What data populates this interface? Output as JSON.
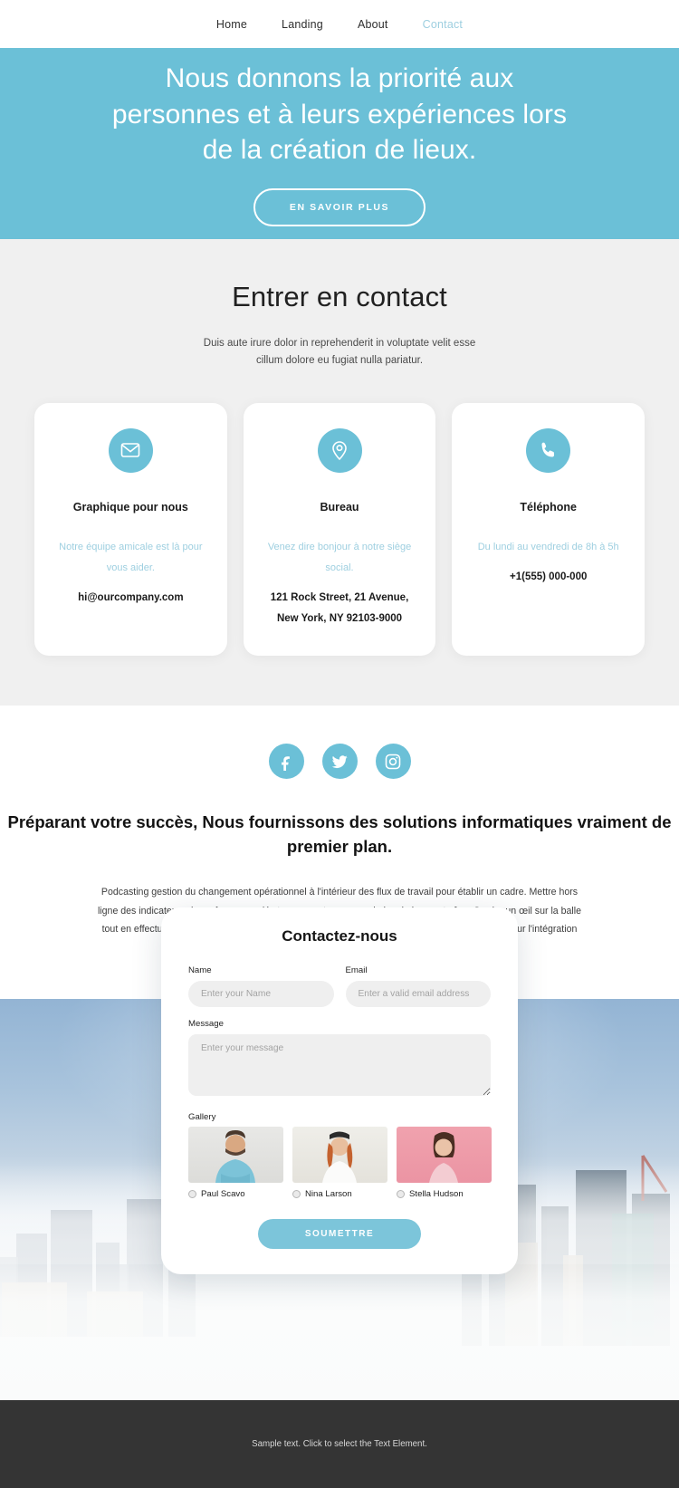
{
  "nav": {
    "items": [
      {
        "label": "Home",
        "active": false
      },
      {
        "label": "Landing",
        "active": false
      },
      {
        "label": "About",
        "active": false
      },
      {
        "label": "Contact",
        "active": true
      }
    ]
  },
  "hero": {
    "heading": "Nous donnons la priorité aux personnes et à leurs expériences lors de la création de lieux.",
    "button_label": "EN SAVOIR PLUS",
    "background_color": "#6bc0d7"
  },
  "contact": {
    "heading": "Entrer en contact",
    "subtitle": "Duis aute irure dolor in reprehenderit in voluptate velit esse cillum dolore eu fugiat nulla pariatur.",
    "cards": [
      {
        "icon": "envelope-icon",
        "title": "Graphique pour nous",
        "description": "Notre équipe amicale est là pour vous aider.",
        "value": "hi@ourcompany.com"
      },
      {
        "icon": "map-pin-icon",
        "title": "Bureau",
        "description": "Venez dire bonjour à notre siège social.",
        "value": "121 Rock Street, 21 Avenue,\nNew York, NY 92103-9000"
      },
      {
        "icon": "phone-icon",
        "title": "Téléphone",
        "description": "Du lundi au vendredi de 8h à 5h",
        "value": "+1(555) 000-000"
      }
    ]
  },
  "about": {
    "socials": [
      {
        "name": "facebook-icon",
        "label": "Facebook"
      },
      {
        "name": "twitter-icon",
        "label": "Twitter"
      },
      {
        "name": "instagram-icon",
        "label": "Instagram"
      }
    ],
    "heading": "Préparant votre succès, Nous fournissons des solutions informatiques vraiment de premier plan.",
    "paragraph": "Podcasting gestion du changement opérationnel à l'intérieur des flux de travail pour établir un cadre. Mettre hors ligne des indicateurs de performance clés transparents pour maximiser la longue traîne. Garder un œil sur la balle tout en effectuant une plongée profonde sur la mentalité de start-up pour dériver la convergence sur l'intégration multiplateforme."
  },
  "form": {
    "title": "Contactez-nous",
    "name_label": "Name",
    "name_placeholder": "Enter your Name",
    "email_label": "Email",
    "email_placeholder": "Enter a valid email address",
    "message_label": "Message",
    "message_placeholder": "Enter your message",
    "gallery_label": "Gallery",
    "gallery": [
      {
        "name": "Paul Scavo",
        "selected": false
      },
      {
        "name": "Nina Larson",
        "selected": false
      },
      {
        "name": "Stella Hudson",
        "selected": false
      }
    ],
    "submit_label": "SOUMETTRE",
    "submit_color": "#7cc5da"
  },
  "footer": {
    "text": "Sample text. Click to select the Text Element.",
    "background_color": "#343434"
  }
}
